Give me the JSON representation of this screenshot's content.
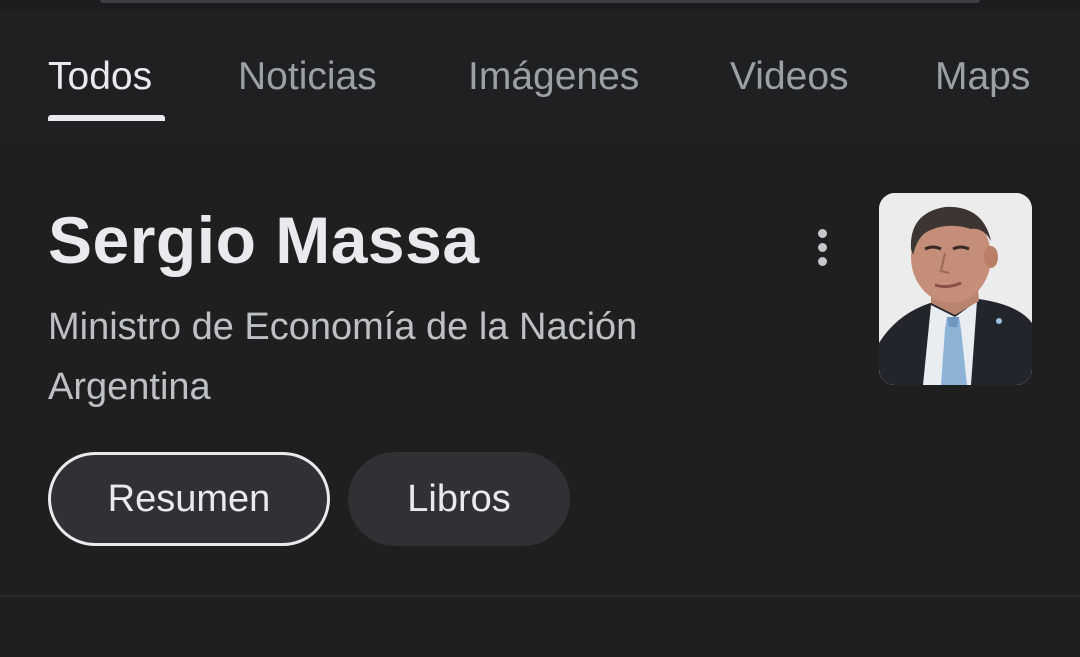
{
  "tabs": [
    {
      "label": "Todos",
      "active": true
    },
    {
      "label": "Noticias",
      "active": false
    },
    {
      "label": "Imágenes",
      "active": false
    },
    {
      "label": "Videos",
      "active": false
    },
    {
      "label": "Maps",
      "active": false
    }
  ],
  "entity": {
    "title": "Sergio Massa",
    "subtitle": "Ministro de Economía de la Nación Argentina",
    "more_icon": "more-vert-icon",
    "photo_icon": "person-portrait"
  },
  "chips": {
    "resumen": "Resumen",
    "libros": "Libros"
  },
  "colors": {
    "background": "#1f1f1f",
    "tabs_background": "#1f2022",
    "active_text": "#e8eaed",
    "inactive_text": "#9aa0a6",
    "chip_background": "#303134"
  }
}
